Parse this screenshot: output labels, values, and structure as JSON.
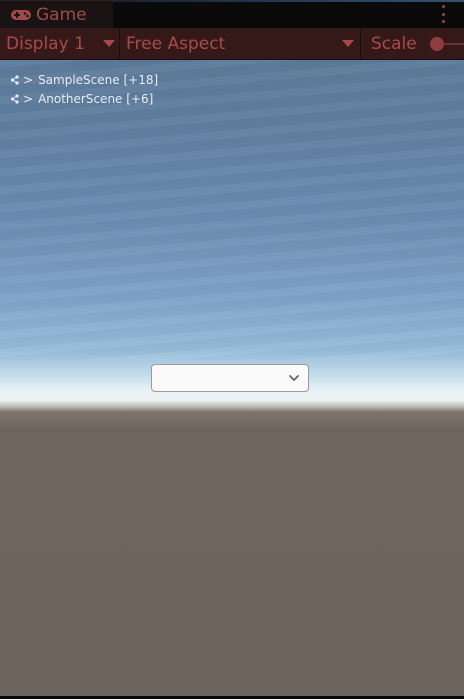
{
  "tab": {
    "label": "Game",
    "icon": "gamepad-icon"
  },
  "toolbar": {
    "display_label": "Display 1",
    "aspect_label": "Free Aspect",
    "scale_label": "Scale"
  },
  "hierarchy": [
    {
      "label": "SampleScene [+18]",
      "icon": "scene-graph-icon"
    },
    {
      "label": "AnotherScene [+6]",
      "icon": "scene-graph-icon"
    }
  ],
  "dropdown": {
    "value": ""
  },
  "colors": {
    "tab_text": "#a04a4a",
    "toolbar_bg": "#351919",
    "toolbar_text": "#a84a4a",
    "ground": "#6d645d",
    "sky_top": "#5d7a9a",
    "horizon": "#eef3f3"
  }
}
